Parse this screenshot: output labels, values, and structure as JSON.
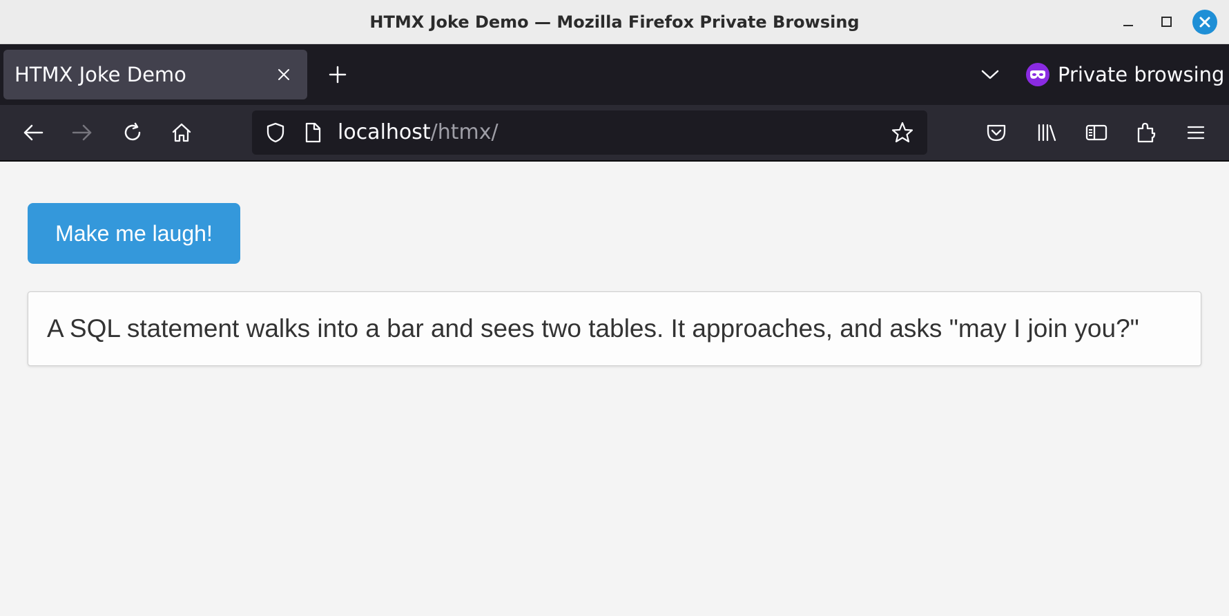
{
  "window": {
    "title": "HTMX Joke Demo — Mozilla Firefox Private Browsing",
    "controls": [
      "minimize-icon",
      "maximize-icon",
      "close-icon"
    ]
  },
  "tabs": [
    {
      "title": "HTMX Joke Demo",
      "active": true,
      "close_icon": "close-icon"
    }
  ],
  "tabstrip": {
    "new_tab_icon": "plus-icon",
    "list_all_tabs_icon": "chevron-down-icon",
    "private_label": "Private browsing",
    "private_icon": "private-mask-icon"
  },
  "navbar": {
    "back_icon": "arrow-left-icon",
    "forward_icon": "arrow-right-icon",
    "reload_icon": "reload-icon",
    "home_icon": "home-icon",
    "url": {
      "host": "localhost",
      "path": "/htmx/"
    },
    "toolbar_icons": [
      "pocket-icon",
      "library-icon",
      "sidebar-icon",
      "extensions-icon",
      "menu-icon"
    ]
  },
  "page": {
    "button_label": "Make me laugh!",
    "joke": "A SQL statement walks into a bar and sees two tables. It approaches, and asks \"may I join you?\""
  },
  "colors": {
    "accent_button": "#3498db",
    "private_purple": "#8a2be2",
    "window_close_blue": "#1f8fd6"
  }
}
